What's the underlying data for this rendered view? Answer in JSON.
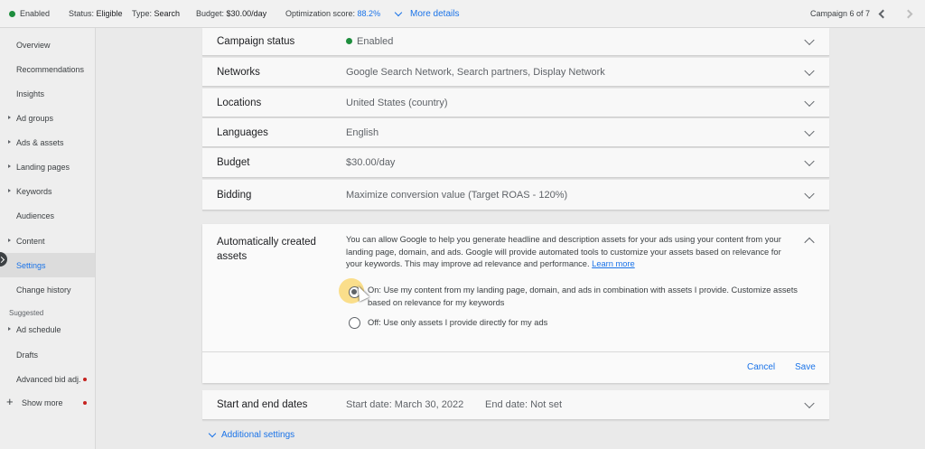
{
  "topbar": {
    "status": "Enabled",
    "status_label": "Status:",
    "status_value": "Eligible",
    "type_label": "Type:",
    "type_value": "Search",
    "budget_label": "Budget:",
    "budget_value": "$30.00/day",
    "opt_label": "Optimization score:",
    "opt_value": "88.2%",
    "more_details": "More details",
    "campaign_counter": "Campaign 6 of 7"
  },
  "sidebar": {
    "items": [
      {
        "label": "Overview"
      },
      {
        "label": "Recommendations"
      },
      {
        "label": "Insights"
      },
      {
        "label": "Ad groups"
      },
      {
        "label": "Ads & assets"
      },
      {
        "label": "Landing pages"
      },
      {
        "label": "Keywords"
      },
      {
        "label": "Audiences"
      },
      {
        "label": "Content"
      },
      {
        "label": "Settings"
      },
      {
        "label": "Change history"
      }
    ],
    "suggested_heading": "Suggested",
    "suggested": [
      {
        "label": "Ad schedule"
      },
      {
        "label": "Drafts"
      },
      {
        "label": "Advanced bid adj."
      }
    ],
    "show_more": "Show more"
  },
  "settings": [
    {
      "label": "Campaign status",
      "value": "Enabled"
    },
    {
      "label": "Networks",
      "value": "Google Search Network, Search partners, Display Network"
    },
    {
      "label": "Locations",
      "value": "United States (country)"
    },
    {
      "label": "Languages",
      "value": "English"
    },
    {
      "label": "Budget",
      "value": "$30.00/day"
    },
    {
      "label": "Bidding",
      "value": "Maximize conversion value (Target ROAS - 120%)"
    }
  ],
  "auto_assets": {
    "label": "Automatically created assets",
    "description": "You can allow Google to help you generate headline and description assets for your ads using your content from your landing page, domain, and ads. Google will provide automated tools to customize your assets based on relevance for your keywords. This may improve ad relevance and performance.",
    "learn_more": "Learn more",
    "option_on": "On: Use my content from my landing page, domain, and ads in combination with assets I provide. Customize assets based on relevance for my keywords",
    "option_off": "Off: Use only assets I provide directly for my ads",
    "cancel": "Cancel",
    "save": "Save"
  },
  "dates": {
    "label": "Start and end dates",
    "start": "Start date: March 30, 2022",
    "end": "End date: Not set"
  },
  "additional_settings": "Additional settings"
}
